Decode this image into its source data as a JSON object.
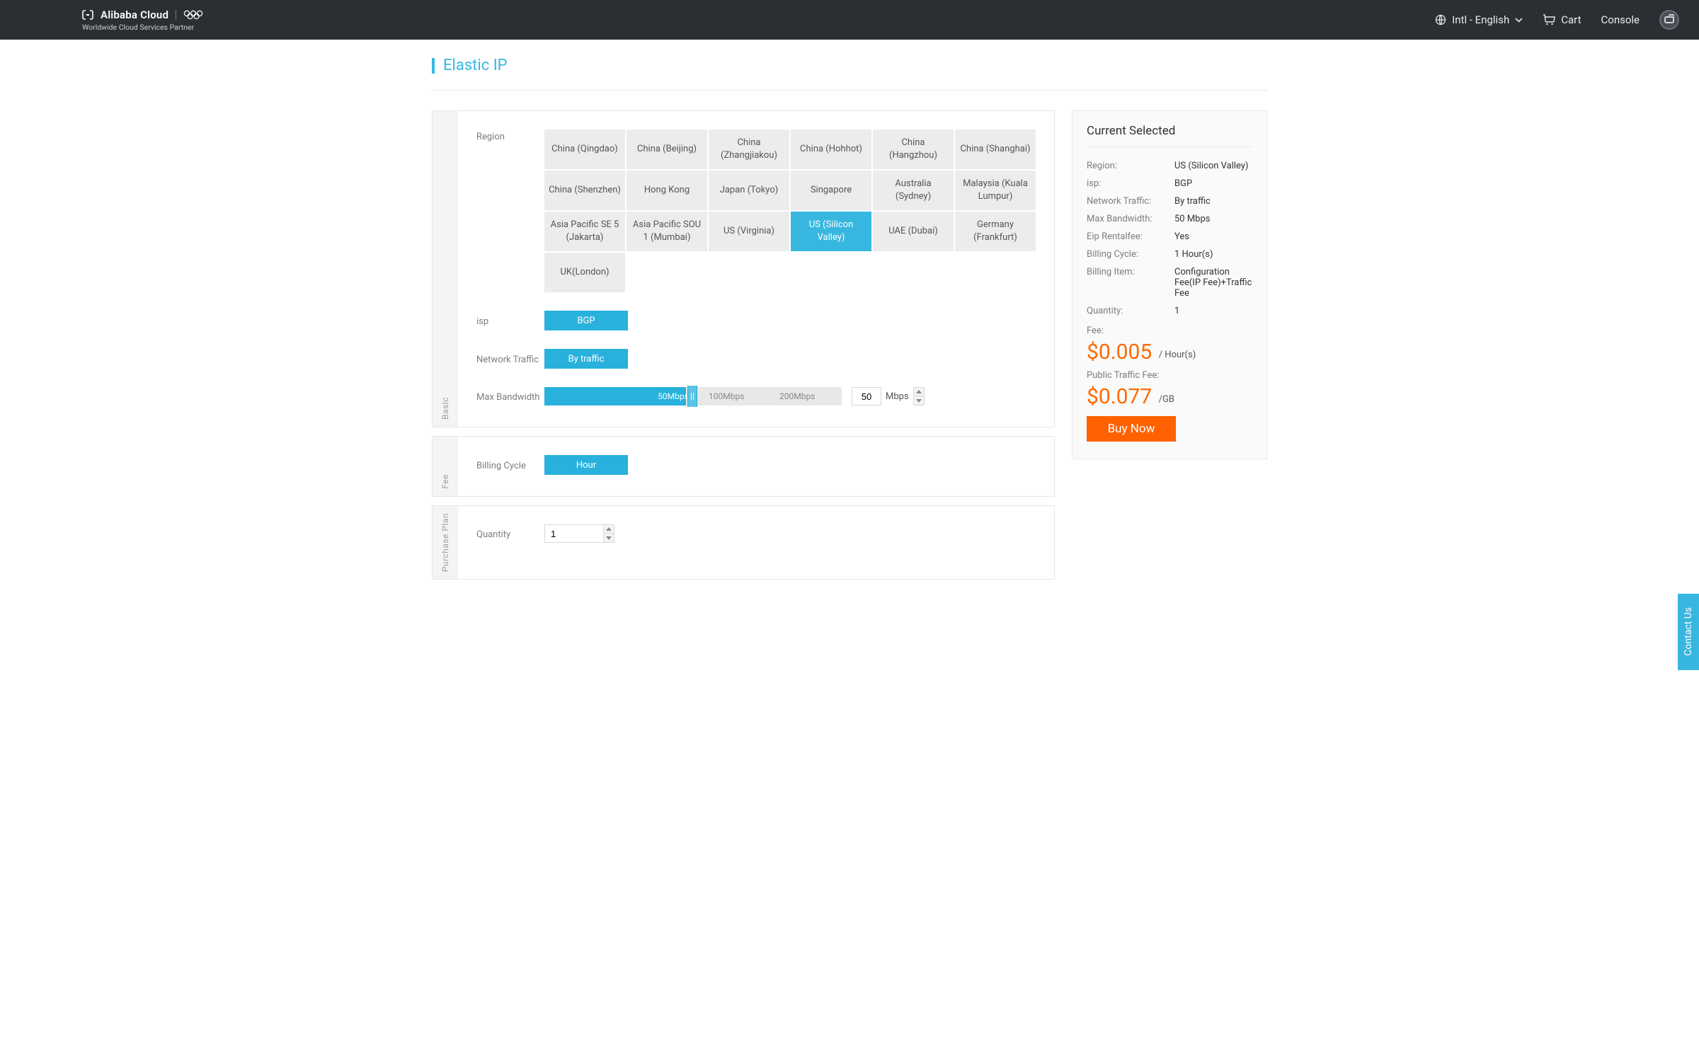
{
  "header": {
    "brand_name": "Alibaba Cloud",
    "brand_tagline": "Worldwide Cloud Services Partner",
    "lang_label": "Intl - English",
    "cart_label": "Cart",
    "console_label": "Console"
  },
  "page": {
    "title": "Elastic IP"
  },
  "sections": {
    "basic_label": "Basic",
    "fee_label": "Fee",
    "purchase_label": "Purchase Plan"
  },
  "form": {
    "region_label": "Region",
    "isp_label": "isp",
    "traffic_label": "Network Traffic",
    "bw_label": "Max Bandwidth",
    "cycle_label": "Billing Cycle",
    "qty_label": "Quantity",
    "regions": [
      {
        "name": "China (Qingdao)",
        "selected": false
      },
      {
        "name": "China (Beijing)",
        "selected": false
      },
      {
        "name": "China (Zhangjiakou)",
        "selected": false
      },
      {
        "name": "China (Hohhot)",
        "selected": false
      },
      {
        "name": "China (Hangzhou)",
        "selected": false
      },
      {
        "name": "China (Shanghai)",
        "selected": false
      },
      {
        "name": "China (Shenzhen)",
        "selected": false
      },
      {
        "name": "Hong Kong",
        "selected": false
      },
      {
        "name": "Japan (Tokyo)",
        "selected": false
      },
      {
        "name": "Singapore",
        "selected": false
      },
      {
        "name": "Australia (Sydney)",
        "selected": false
      },
      {
        "name": "Malaysia (Kuala Lumpur)",
        "selected": false
      },
      {
        "name": "Asia Pacific SE 5 (Jakarta)",
        "selected": false
      },
      {
        "name": "Asia Pacific SOU 1 (Mumbai)",
        "selected": false
      },
      {
        "name": "US (Virginia)",
        "selected": false
      },
      {
        "name": "US (Silicon Valley)",
        "selected": true
      },
      {
        "name": "UAE (Dubai)",
        "selected": false
      },
      {
        "name": "Germany (Frankfurt)",
        "selected": false
      },
      {
        "name": "UK(London)",
        "selected": false
      }
    ],
    "isp_value": "BGP",
    "traffic_value": "By traffic",
    "bw_ticks": {
      "t50": "50Mbps",
      "t100": "100Mbps",
      "t200": "200Mbps"
    },
    "bw_value": "50",
    "bw_unit": "Mbps",
    "cycle_value": "Hour",
    "qty_value": "1"
  },
  "summary": {
    "title": "Current Selected",
    "rows": {
      "region_l": "Region:",
      "region_v": "US (Silicon Valley)",
      "isp_l": "isp:",
      "isp_v": "BGP",
      "traffic_l": "Network Traffic:",
      "traffic_v": "By traffic",
      "bw_l": "Max Bandwidth:",
      "bw_v": "50 Mbps",
      "rental_l": "Eip Rentalfee:",
      "rental_v": "Yes",
      "cycle_l": "Billing Cycle:",
      "cycle_v": "1 Hour(s)",
      "item_l": "Billing Item:",
      "item_v": "Configuration Fee(IP Fee)+Traffic Fee",
      "qty_l": "Quantity:",
      "qty_v": "1",
      "fee_l": "Fee:",
      "fee_price": "$0.005",
      "fee_unit": "/ Hour(s)",
      "pub_l": "Public Traffic Fee:",
      "pub_price": "$0.077",
      "pub_unit": "/GB"
    },
    "buy_label": "Buy Now"
  },
  "contact": {
    "label": "Contact Us"
  }
}
